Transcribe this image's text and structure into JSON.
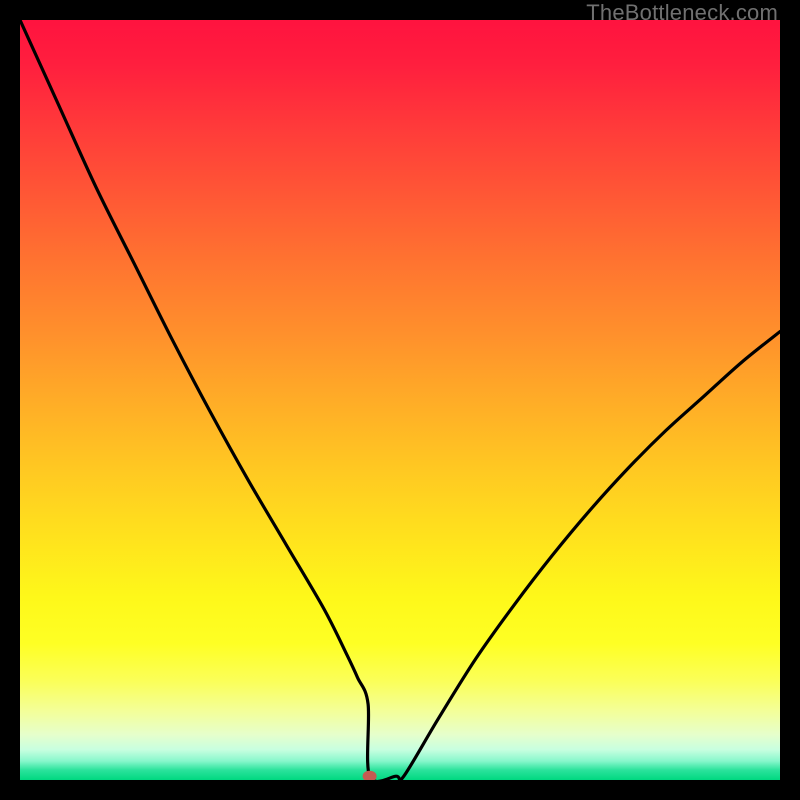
{
  "watermark": "TheBottleneck.com",
  "chart_data": {
    "type": "line",
    "title": "",
    "xlabel": "",
    "ylabel": "",
    "xlim": [
      0,
      100
    ],
    "ylim": [
      0,
      100
    ],
    "x": [
      0,
      5,
      10,
      15,
      20,
      25,
      30,
      35,
      40,
      43,
      44.4,
      45.8,
      46,
      49.5,
      50.5,
      55,
      60,
      65,
      70,
      75,
      80,
      85,
      90,
      95,
      100
    ],
    "values": [
      100,
      89,
      78,
      68,
      58,
      48.5,
      39.5,
      31,
      22.5,
      16.5,
      13.5,
      10,
      0.5,
      0.5,
      0.5,
      8,
      16,
      23,
      29.5,
      35.5,
      41,
      46,
      50.5,
      55,
      59
    ],
    "marker": {
      "x": 46,
      "y": 0.5,
      "color": "#c45b52"
    }
  }
}
